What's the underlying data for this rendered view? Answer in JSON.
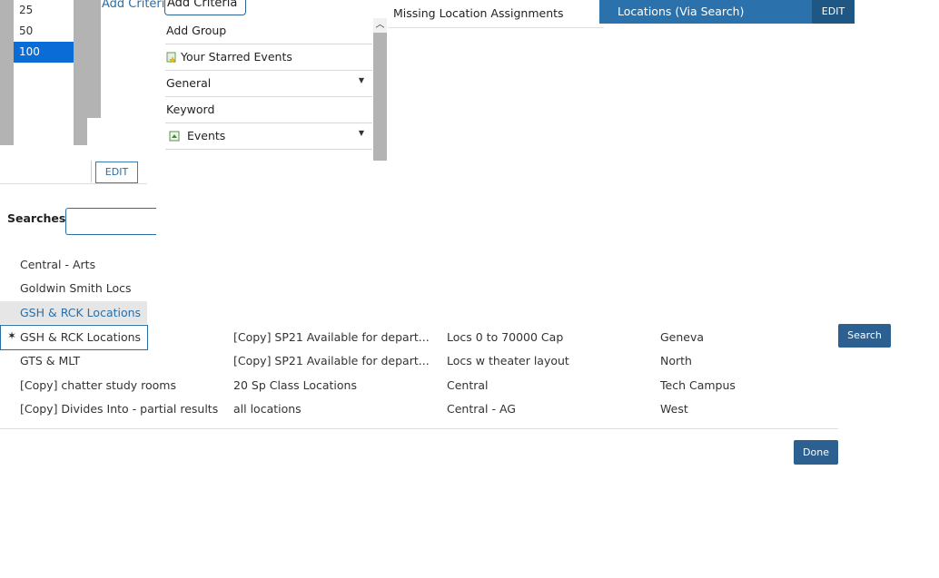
{
  "page_size": {
    "options": [
      "25",
      "50",
      "100"
    ],
    "selected": "100"
  },
  "criteria": {
    "add_criteria_link": "Add Criteria",
    "add_criteria_button": "Add Criteria",
    "menu": [
      {
        "label": "Add Group",
        "icon": "",
        "caret": false
      },
      {
        "label": "Your Starred Events",
        "icon": "starred-events-icon",
        "caret": false
      },
      {
        "label": "General",
        "icon": "",
        "caret": true
      },
      {
        "label": "Keyword",
        "icon": "",
        "caret": false
      },
      {
        "label": "Events",
        "icon": "events-icon",
        "caret": true
      }
    ]
  },
  "header": {
    "missing_location": "Missing Location Assignments",
    "locations_via_search": "Locations (Via Search)",
    "edit_label": "EDIT"
  },
  "edit_button": "EDIT",
  "searches": {
    "label": "Searches",
    "input_value": ""
  },
  "saved_searches": {
    "col1_top": [
      "Central - Arts",
      "Goldwin Smith Locs"
    ],
    "highlighted": "GSH & RCK Locations",
    "selected": "GSH & RCK Locations",
    "selected_marker": "✶",
    "columns": [
      [
        "GTS & MLT",
        "[Copy] chatter study rooms",
        "[Copy] Divides Into - partial results"
      ],
      [
        "[Copy] SP21 Available for depart...",
        "[Copy] SP21 Available for depart...",
        "20 Sp Class Locations",
        "all locations"
      ],
      [
        "Locs 0 to 70000 Cap",
        "Locs w theater layout",
        "Central",
        "Central - AG"
      ],
      [
        "Geneva",
        "North",
        "Tech Campus",
        "West"
      ]
    ]
  },
  "buttons": {
    "search": "Search",
    "done": "Done"
  },
  "colors": {
    "accent": "#2b72ad",
    "dark_accent": "#1e5783",
    "select_blue": "#0a6cd6"
  }
}
